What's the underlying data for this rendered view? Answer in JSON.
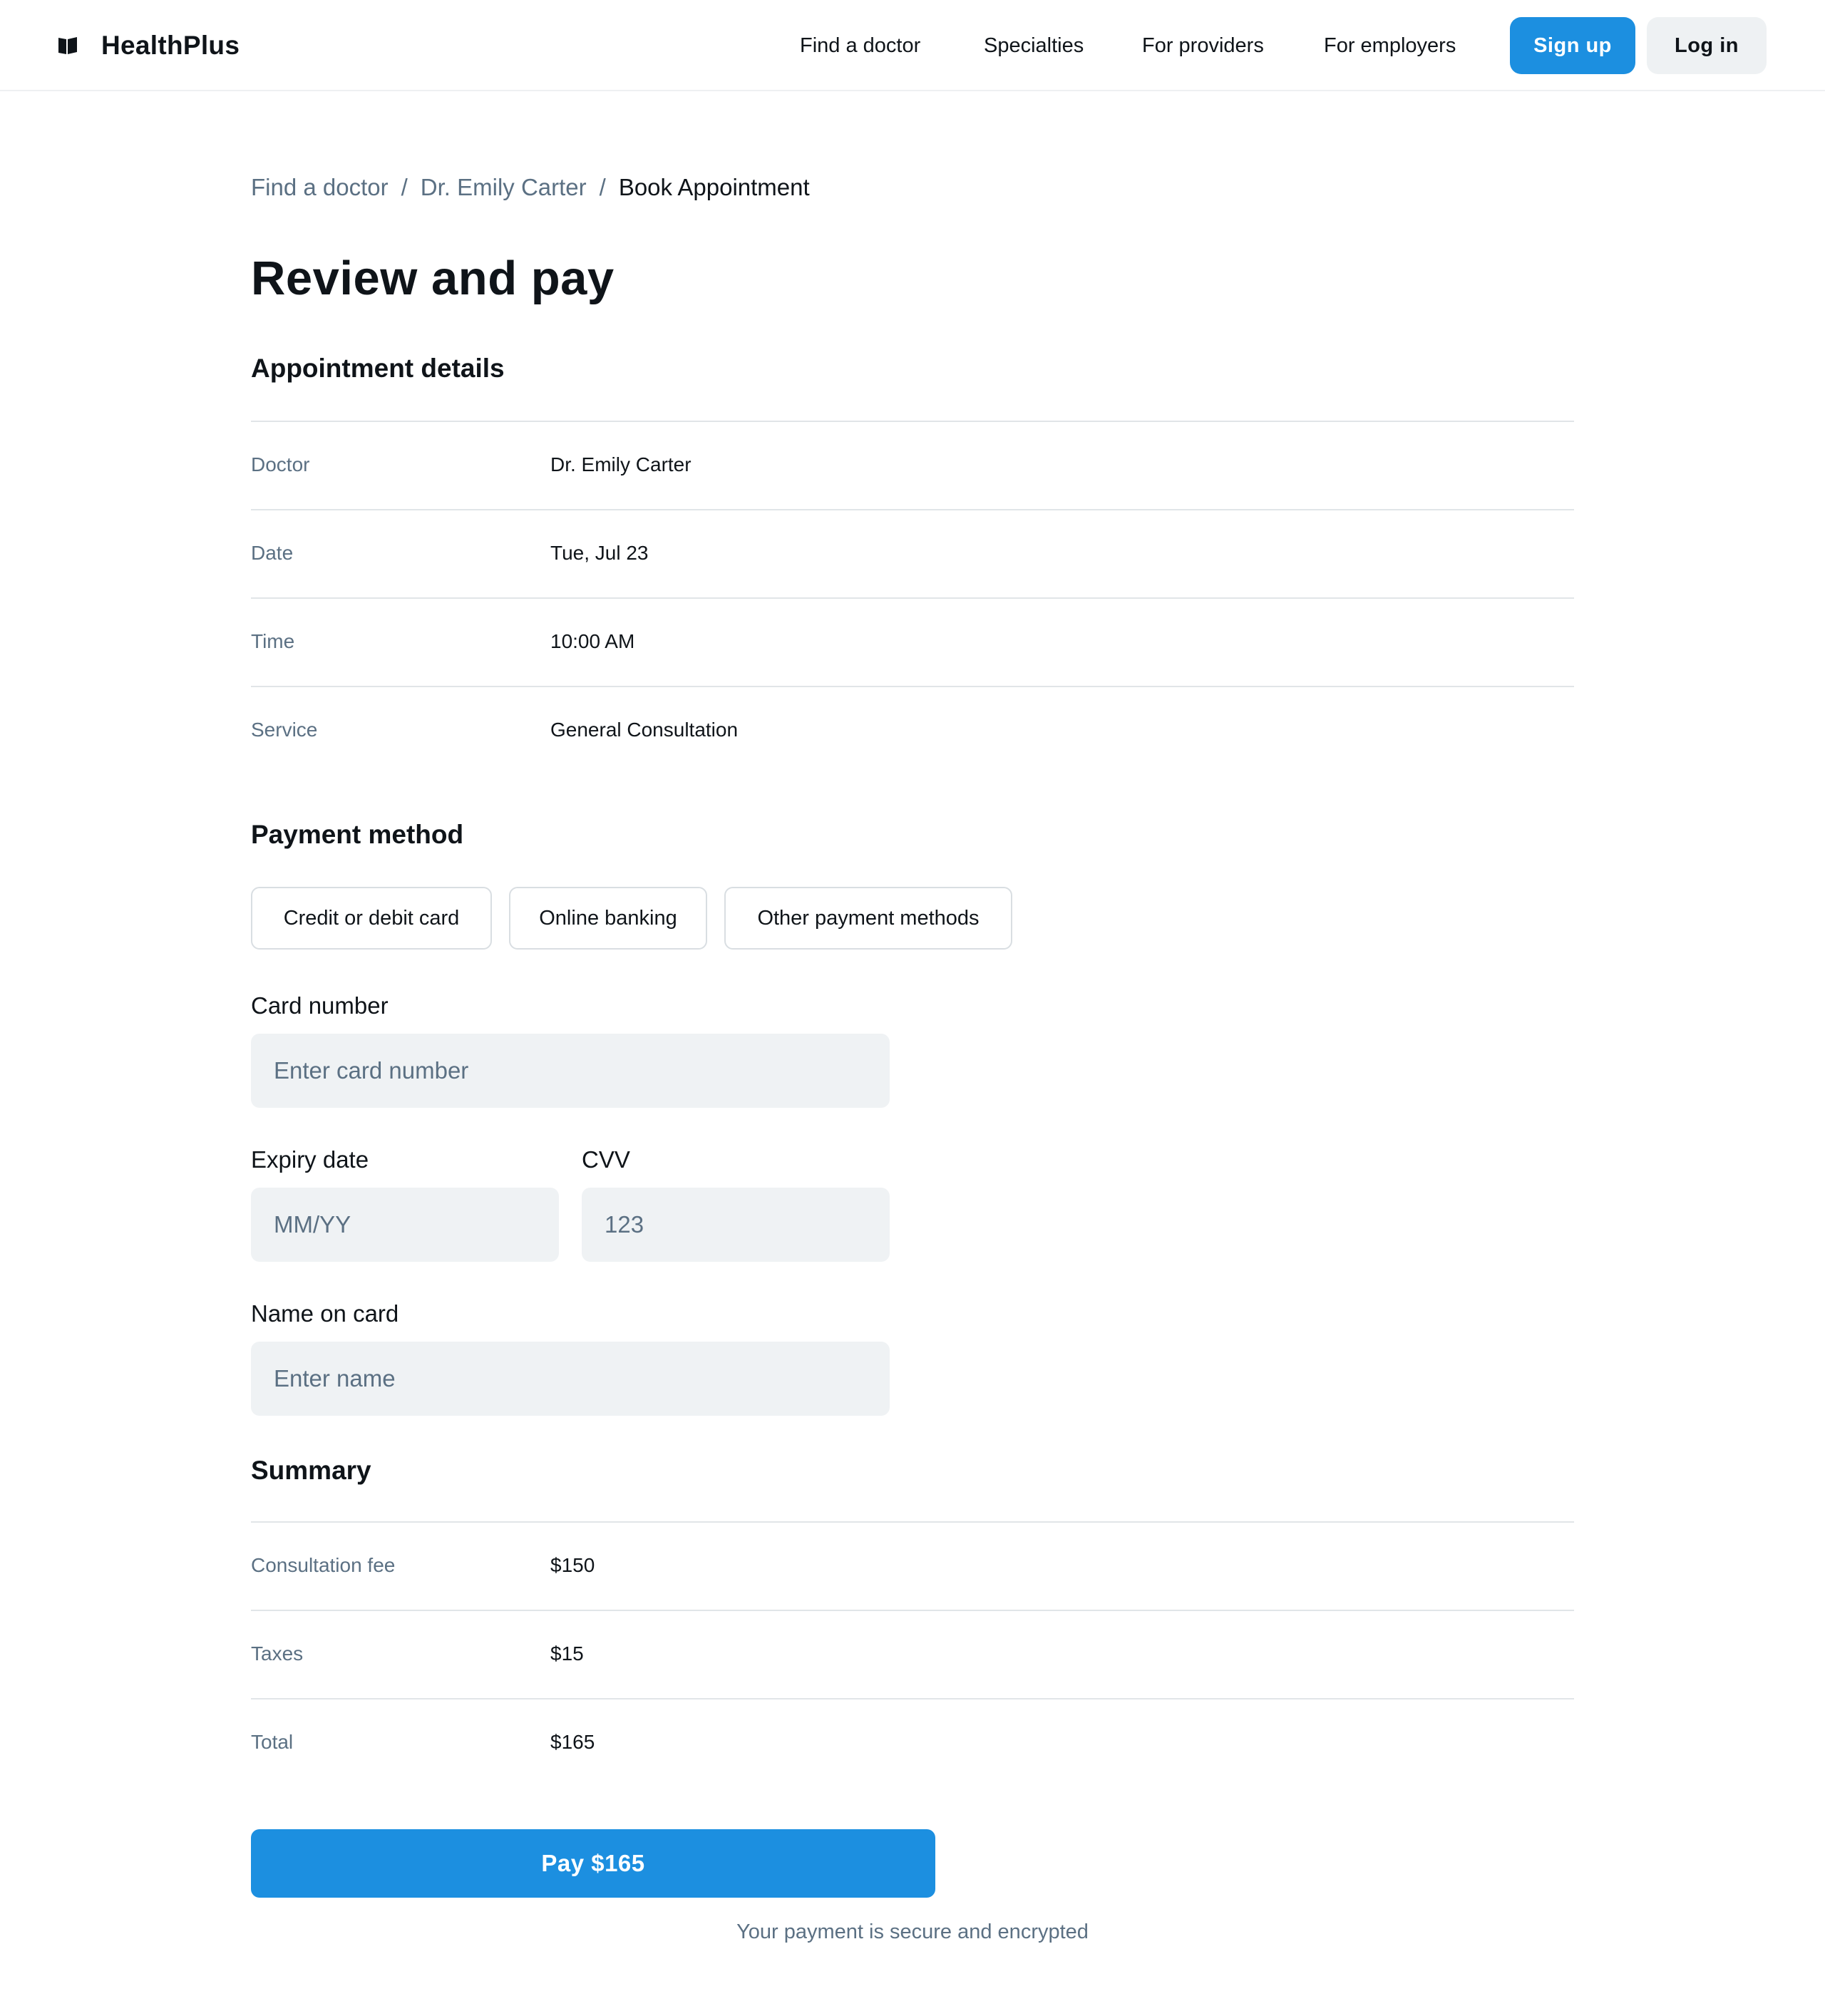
{
  "brand": {
    "name": "HealthPlus",
    "icon": "book-icon"
  },
  "nav": {
    "links": [
      "Find a doctor",
      "Specialties",
      "For providers",
      "For employers"
    ],
    "signup_label": "Sign up",
    "login_label": "Log in"
  },
  "breadcrumb": {
    "items": [
      "Find a doctor",
      "Dr. Emily Carter"
    ],
    "separator": "/",
    "current": "Book Appointment"
  },
  "page_title": "Review and pay",
  "appointment": {
    "title": "Appointment details",
    "rows": [
      {
        "label": "Doctor",
        "value": "Dr. Emily Carter"
      },
      {
        "label": "Date",
        "value": "Tue, Jul 23"
      },
      {
        "label": "Time",
        "value": "10:00 AM"
      },
      {
        "label": "Service",
        "value": "General Consultation"
      }
    ]
  },
  "payment": {
    "title": "Payment method",
    "tabs": [
      "Credit or debit card",
      "Online banking",
      "Other payment methods"
    ],
    "card_number": {
      "label": "Card number",
      "placeholder": "Enter card number",
      "value": ""
    },
    "expiry": {
      "label": "Expiry date",
      "placeholder": "MM/YY",
      "value": ""
    },
    "cvv": {
      "label": "CVV",
      "placeholder": "123",
      "value": ""
    },
    "name": {
      "label": "Name on card",
      "placeholder": "Enter name",
      "value": ""
    }
  },
  "summary": {
    "title": "Summary",
    "rows": [
      {
        "label": "Consultation fee",
        "value": "$150"
      },
      {
        "label": "Taxes",
        "value": "$15"
      },
      {
        "label": "Total",
        "value": "$165"
      }
    ]
  },
  "pay_button_label": "Pay $165",
  "secure_note": "Your payment is secure and encrypted",
  "colors": {
    "accent": "#1c8fe0",
    "muted_text": "#5b7083",
    "input_bg": "#eff2f4",
    "divider": "#e1e5e8"
  }
}
